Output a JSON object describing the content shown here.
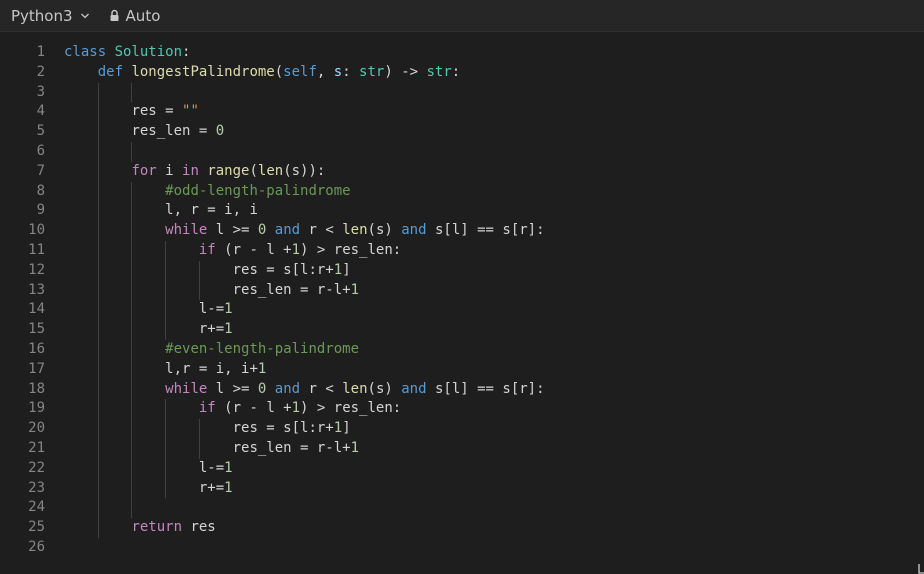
{
  "toolbar": {
    "language": "Python3",
    "mode": "Auto"
  },
  "code": {
    "lines": [
      {
        "n": "1",
        "indent": 0,
        "tokens": [
          {
            "t": "class ",
            "c": "kw"
          },
          {
            "t": "Solution",
            "c": "cls"
          },
          {
            "t": ":",
            "c": ""
          }
        ]
      },
      {
        "n": "2",
        "indent": 1,
        "tokens": [
          {
            "t": "def ",
            "c": "kw"
          },
          {
            "t": "longestPalindrome",
            "c": "fn"
          },
          {
            "t": "(",
            "c": ""
          },
          {
            "t": "self",
            "c": "self"
          },
          {
            "t": ", ",
            "c": ""
          },
          {
            "t": "s",
            "c": "param"
          },
          {
            "t": ": ",
            "c": ""
          },
          {
            "t": "str",
            "c": "cls"
          },
          {
            "t": ") -> ",
            "c": ""
          },
          {
            "t": "str",
            "c": "cls"
          },
          {
            "t": ":",
            "c": ""
          }
        ]
      },
      {
        "n": "3",
        "indent": 0,
        "tokens": []
      },
      {
        "n": "4",
        "indent": 2,
        "tokens": [
          {
            "t": "res = ",
            "c": ""
          },
          {
            "t": "\"\"",
            "c": "str"
          }
        ]
      },
      {
        "n": "5",
        "indent": 2,
        "tokens": [
          {
            "t": "res_len = ",
            "c": ""
          },
          {
            "t": "0",
            "c": "num"
          }
        ]
      },
      {
        "n": "6",
        "indent": 0,
        "tokens": []
      },
      {
        "n": "7",
        "indent": 2,
        "tokens": [
          {
            "t": "for ",
            "c": "ctl"
          },
          {
            "t": "i ",
            "c": ""
          },
          {
            "t": "in ",
            "c": "ctl"
          },
          {
            "t": "range",
            "c": "fn"
          },
          {
            "t": "(",
            "c": ""
          },
          {
            "t": "len",
            "c": "fn"
          },
          {
            "t": "(s)):",
            "c": ""
          }
        ]
      },
      {
        "n": "8",
        "indent": 3,
        "tokens": [
          {
            "t": "#odd-length-palindrome",
            "c": "cmt"
          }
        ]
      },
      {
        "n": "9",
        "indent": 3,
        "tokens": [
          {
            "t": "l, r = i, i",
            "c": ""
          }
        ]
      },
      {
        "n": "10",
        "indent": 3,
        "tokens": [
          {
            "t": "while ",
            "c": "ctl"
          },
          {
            "t": "l >= ",
            "c": ""
          },
          {
            "t": "0",
            "c": "num"
          },
          {
            "t": " ",
            "c": ""
          },
          {
            "t": "and",
            "c": "kw"
          },
          {
            "t": " r < ",
            "c": ""
          },
          {
            "t": "len",
            "c": "fn"
          },
          {
            "t": "(s) ",
            "c": ""
          },
          {
            "t": "and",
            "c": "kw"
          },
          {
            "t": " s[l] == s[r]:",
            "c": ""
          }
        ]
      },
      {
        "n": "11",
        "indent": 4,
        "tokens": [
          {
            "t": "if ",
            "c": "ctl"
          },
          {
            "t": "(r - l +",
            "c": ""
          },
          {
            "t": "1",
            "c": "num"
          },
          {
            "t": ") > res_len:",
            "c": ""
          }
        ]
      },
      {
        "n": "12",
        "indent": 5,
        "tokens": [
          {
            "t": "res = s[l:r+",
            "c": ""
          },
          {
            "t": "1",
            "c": "num"
          },
          {
            "t": "]",
            "c": ""
          }
        ]
      },
      {
        "n": "13",
        "indent": 5,
        "tokens": [
          {
            "t": "res_len = r-l+",
            "c": ""
          },
          {
            "t": "1",
            "c": "num"
          }
        ]
      },
      {
        "n": "14",
        "indent": 4,
        "tokens": [
          {
            "t": "l-=",
            "c": ""
          },
          {
            "t": "1",
            "c": "num"
          }
        ]
      },
      {
        "n": "15",
        "indent": 4,
        "tokens": [
          {
            "t": "r+=",
            "c": ""
          },
          {
            "t": "1",
            "c": "num"
          }
        ]
      },
      {
        "n": "16",
        "indent": 3,
        "tokens": [
          {
            "t": "#even-length-palindrome",
            "c": "cmt"
          }
        ]
      },
      {
        "n": "17",
        "indent": 3,
        "tokens": [
          {
            "t": "l,r = i, i+",
            "c": ""
          },
          {
            "t": "1",
            "c": "num"
          }
        ]
      },
      {
        "n": "18",
        "indent": 3,
        "tokens": [
          {
            "t": "while ",
            "c": "ctl"
          },
          {
            "t": "l >= ",
            "c": ""
          },
          {
            "t": "0",
            "c": "num"
          },
          {
            "t": " ",
            "c": ""
          },
          {
            "t": "and",
            "c": "kw"
          },
          {
            "t": " r < ",
            "c": ""
          },
          {
            "t": "len",
            "c": "fn"
          },
          {
            "t": "(s) ",
            "c": ""
          },
          {
            "t": "and",
            "c": "kw"
          },
          {
            "t": " s[l] == s[r]:",
            "c": ""
          }
        ]
      },
      {
        "n": "19",
        "indent": 4,
        "tokens": [
          {
            "t": "if ",
            "c": "ctl"
          },
          {
            "t": "(r - l +",
            "c": ""
          },
          {
            "t": "1",
            "c": "num"
          },
          {
            "t": ") > res_len:",
            "c": ""
          }
        ]
      },
      {
        "n": "20",
        "indent": 5,
        "tokens": [
          {
            "t": "res = s[l:r+",
            "c": ""
          },
          {
            "t": "1",
            "c": "num"
          },
          {
            "t": "]",
            "c": ""
          }
        ]
      },
      {
        "n": "21",
        "indent": 5,
        "tokens": [
          {
            "t": "res_len = r-l+",
            "c": ""
          },
          {
            "t": "1",
            "c": "num"
          }
        ]
      },
      {
        "n": "22",
        "indent": 4,
        "tokens": [
          {
            "t": "l-=",
            "c": ""
          },
          {
            "t": "1",
            "c": "num"
          }
        ]
      },
      {
        "n": "23",
        "indent": 4,
        "tokens": [
          {
            "t": "r+=",
            "c": ""
          },
          {
            "t": "1",
            "c": "num"
          }
        ]
      },
      {
        "n": "24",
        "indent": 0,
        "tokens": []
      },
      {
        "n": "25",
        "indent": 2,
        "tokens": [
          {
            "t": "return ",
            "c": "ctl"
          },
          {
            "t": "res",
            "c": ""
          }
        ]
      },
      {
        "n": "26",
        "indent": 0,
        "tokens": []
      }
    ]
  },
  "icons": {
    "chevron": "chevron-down-icon",
    "lock": "lock-icon"
  },
  "colors": {
    "background": "#1e1e1e",
    "keyword": "#569cd6",
    "control": "#c586c0",
    "class": "#4ec9b0",
    "function": "#dcdcaa",
    "number": "#b5cea8",
    "string": "#ce9178",
    "comment": "#6a9955"
  }
}
